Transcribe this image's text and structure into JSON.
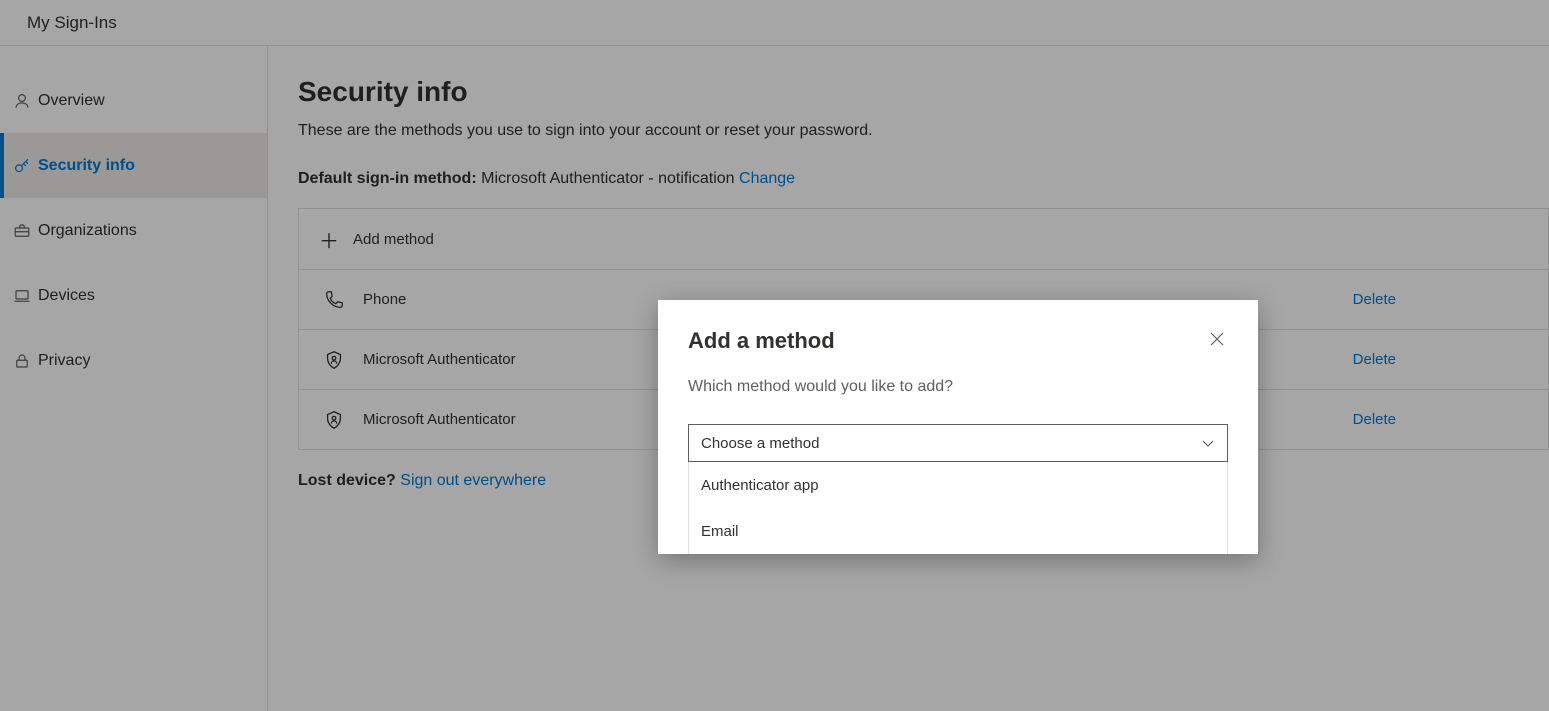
{
  "header": {
    "title": "My Sign-Ins"
  },
  "sidebar": {
    "items": [
      {
        "label": "Overview"
      },
      {
        "label": "Security info"
      },
      {
        "label": "Organizations"
      },
      {
        "label": "Devices"
      },
      {
        "label": "Privacy"
      }
    ]
  },
  "page": {
    "title": "Security info",
    "subtitle": "These are the methods you use to sign into your account or reset your password.",
    "default_label": "Default sign-in method:",
    "default_value": "Microsoft Authenticator - notification",
    "change": "Change",
    "add_method": "Add method",
    "lost_label": "Lost device?",
    "lost_link": "Sign out everywhere"
  },
  "methods": [
    {
      "name": "Phone",
      "delete": "Delete"
    },
    {
      "name": "Microsoft Authenticator",
      "delete": "Delete"
    },
    {
      "name": "Microsoft Authenticator",
      "delete": "Delete"
    }
  ],
  "dialog": {
    "title": "Add a method",
    "subtitle": "Which method would you like to add?",
    "placeholder": "Choose a method",
    "options": [
      {
        "label": "Authenticator app"
      },
      {
        "label": "Email"
      }
    ]
  }
}
